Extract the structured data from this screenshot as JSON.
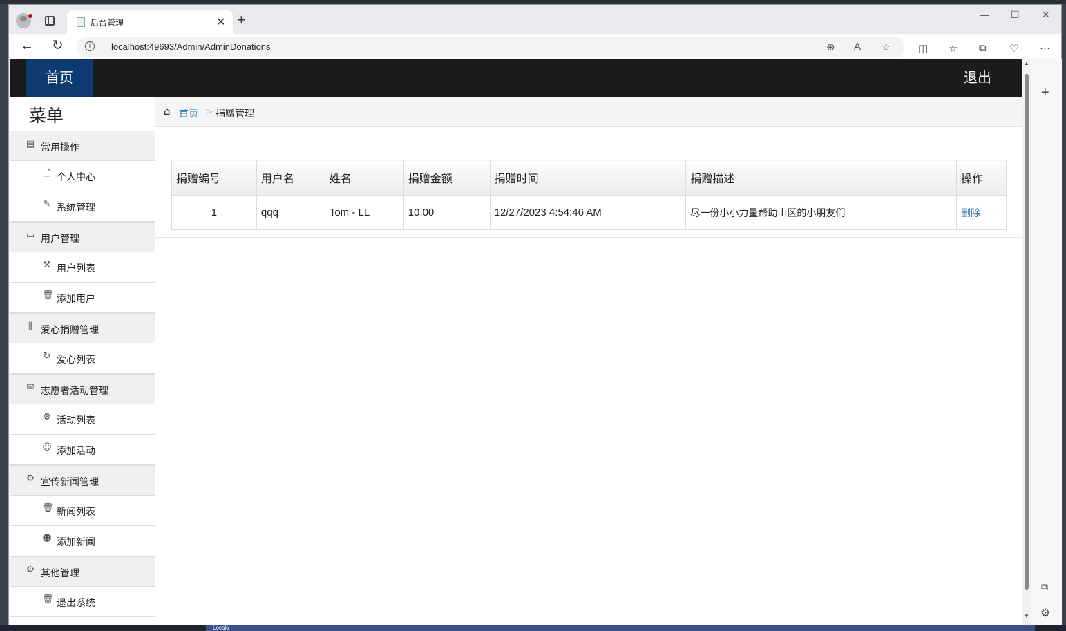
{
  "browser": {
    "tab_title": "后台管理",
    "url": "localhost:49693/Admin/AdminDonations",
    "tab_close": "✕",
    "new_tab": "+",
    "controls": {
      "minimize": "—",
      "maximize": "☐",
      "close": "✕"
    }
  },
  "site": {
    "home": "首页",
    "logout": "退出"
  },
  "menu": {
    "title": "菜单",
    "groups": [
      {
        "label": "常用操作",
        "icon": "list-icon",
        "items": [
          {
            "label": "个人中心",
            "icon": "file-icon"
          },
          {
            "label": "系统管理",
            "icon": "brush-icon"
          }
        ]
      },
      {
        "label": "用户管理",
        "icon": "list-alt-icon",
        "items": [
          {
            "label": "用户列表",
            "icon": "wrench-icon"
          },
          {
            "label": "添加用户",
            "icon": "trash-icon"
          }
        ]
      },
      {
        "label": "爱心捐赠管理",
        "icon": "books-icon",
        "items": [
          {
            "label": "爱心列表",
            "icon": "refresh-icon"
          }
        ]
      },
      {
        "label": "志愿者活动管理",
        "icon": "envelope-icon",
        "items": [
          {
            "label": "活动列表",
            "icon": "cog-icon"
          },
          {
            "label": "添加活动",
            "icon": "smile-icon"
          }
        ]
      },
      {
        "label": "宣传新闻管理",
        "icon": "cog-icon",
        "items": [
          {
            "label": "新闻列表",
            "icon": "trash-icon"
          },
          {
            "label": "添加新闻",
            "icon": "face-icon"
          }
        ]
      },
      {
        "label": "其他管理",
        "icon": "cog-icon",
        "items": [
          {
            "label": "退出系统",
            "icon": "trash-icon"
          }
        ]
      }
    ]
  },
  "breadcrumb": {
    "home": "首页",
    "separator": ">",
    "current": "捐赠管理"
  },
  "table": {
    "headers": [
      "捐赠编号",
      "用户名",
      "姓名",
      "捐赠金额",
      "捐赠时间",
      "捐赠描述",
      "操作"
    ],
    "rows": [
      {
        "id": "1",
        "username": "qqq",
        "name": "Tom - LL",
        "amount": "10.00",
        "time": "12/27/2023 4:54:46 AM",
        "description": "尽一份小小力量帮助山区的小朋友们",
        "action": "删除"
      }
    ]
  },
  "taskbar": {
    "locals": "Locals"
  },
  "colors": {
    "header_bg": "#1b1b1b",
    "home_bg": "#0d3a70",
    "link": "#337ab7"
  }
}
